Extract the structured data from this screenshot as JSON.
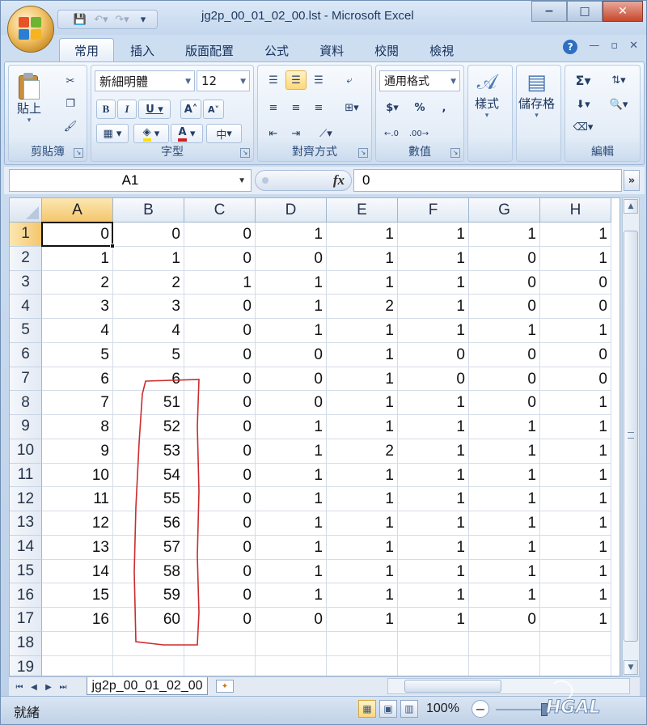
{
  "window": {
    "title": "jg2p_00_01_02_00.lst - Microsoft Excel",
    "controls": {
      "minimize": "−",
      "restore": "□",
      "close": "✕"
    }
  },
  "qat": {
    "save_icon": "save-icon",
    "undo_icon": "undo-icon",
    "redo_icon": "redo-icon"
  },
  "tabs": [
    "常用",
    "插入",
    "版面配置",
    "公式",
    "資料",
    "校閱",
    "檢視"
  ],
  "ribbon": {
    "clipboard": {
      "label": "剪貼簿",
      "paste": "貼上"
    },
    "font": {
      "label": "字型",
      "name": "新細明體",
      "size": "12",
      "bold": "B",
      "italic": "I",
      "underline": "U",
      "grow": "A",
      "shrink": "A",
      "font_color": "A",
      "phonetic": "中"
    },
    "alignment": {
      "label": "對齊方式"
    },
    "number": {
      "label": "數值",
      "format": "通用格式",
      "currency": "$",
      "percent": "%",
      "comma": ","
    },
    "styles": {
      "label": "樣式"
    },
    "cells": {
      "label": "儲存格"
    },
    "editing": {
      "label": "編輯",
      "sum": "Σ"
    }
  },
  "formula_bar": {
    "name_box": "A1",
    "fx": "fx",
    "value": "0"
  },
  "sheet": {
    "columns": [
      "A",
      "B",
      "C",
      "D",
      "E",
      "F",
      "G",
      "H"
    ],
    "rows": [
      [
        "0",
        "0",
        "0",
        "1",
        "1",
        "1",
        "1",
        "1"
      ],
      [
        "1",
        "1",
        "0",
        "0",
        "1",
        "1",
        "0",
        "1"
      ],
      [
        "2",
        "2",
        "1",
        "1",
        "1",
        "1",
        "0",
        "0"
      ],
      [
        "3",
        "3",
        "0",
        "1",
        "2",
        "1",
        "0",
        "0"
      ],
      [
        "4",
        "4",
        "0",
        "1",
        "1",
        "1",
        "1",
        "1"
      ],
      [
        "5",
        "5",
        "0",
        "0",
        "1",
        "0",
        "0",
        "0"
      ],
      [
        "6",
        "6",
        "0",
        "0",
        "1",
        "0",
        "0",
        "0"
      ],
      [
        "7",
        "51",
        "0",
        "0",
        "1",
        "1",
        "0",
        "1"
      ],
      [
        "8",
        "52",
        "0",
        "1",
        "1",
        "1",
        "1",
        "1"
      ],
      [
        "9",
        "53",
        "0",
        "1",
        "2",
        "1",
        "1",
        "1"
      ],
      [
        "10",
        "54",
        "0",
        "1",
        "1",
        "1",
        "1",
        "1"
      ],
      [
        "11",
        "55",
        "0",
        "1",
        "1",
        "1",
        "1",
        "1"
      ],
      [
        "12",
        "56",
        "0",
        "1",
        "1",
        "1",
        "1",
        "1"
      ],
      [
        "13",
        "57",
        "0",
        "1",
        "1",
        "1",
        "1",
        "1"
      ],
      [
        "14",
        "58",
        "0",
        "1",
        "1",
        "1",
        "1",
        "1"
      ],
      [
        "15",
        "59",
        "0",
        "1",
        "1",
        "1",
        "1",
        "1"
      ],
      [
        "16",
        "60",
        "0",
        "0",
        "1",
        "1",
        "0",
        "1"
      ],
      [
        "",
        "",
        "",
        "",
        "",
        "",
        "",
        ""
      ],
      [
        "",
        "",
        "",
        "",
        "",
        "",
        "",
        ""
      ]
    ],
    "row_numbers": [
      "1",
      "2",
      "3",
      "4",
      "5",
      "6",
      "7",
      "8",
      "9",
      "10",
      "11",
      "12",
      "13",
      "14",
      "15",
      "16",
      "17",
      "18",
      "19"
    ],
    "tab_name": "jg2p_00_01_02_00",
    "annotation_color": "#cc2b2b"
  },
  "status": {
    "text": "就緒",
    "zoom": "100%",
    "minus": "−"
  }
}
